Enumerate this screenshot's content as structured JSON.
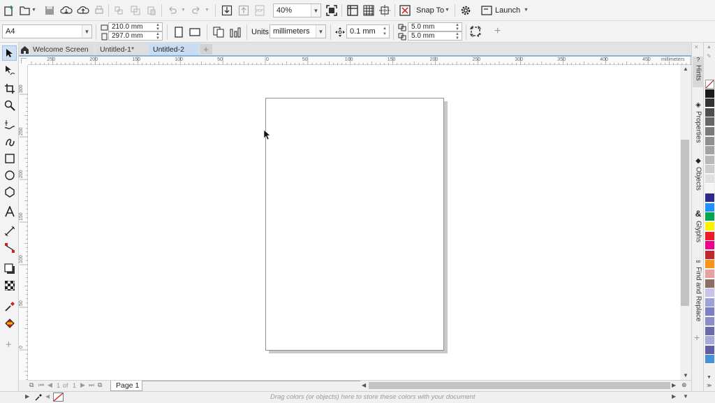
{
  "toolbar": {
    "zoom_value": "40%",
    "snap_label": "Snap To",
    "launch_label": "Launch"
  },
  "property_bar": {
    "page_size": "A4",
    "width_value": "210.0 mm",
    "height_value": "297.0 mm",
    "units_label": "Units:",
    "units_value": "millimeters",
    "nudge_value": "0.1 mm",
    "dup_x_value": "5.0 mm",
    "dup_y_value": "5.0 mm"
  },
  "tabs": [
    {
      "label": "Welcome Screen",
      "active": false
    },
    {
      "label": "Untitled-1*",
      "active": false
    },
    {
      "label": "Untitled-2",
      "active": true
    }
  ],
  "ruler": {
    "unit_label": "millimeters",
    "h_ticks": [
      "250",
      "200",
      "150",
      "100",
      "50",
      "0",
      "50",
      "100",
      "150",
      "200",
      "250",
      "300",
      "350",
      "400",
      "450"
    ],
    "v_ticks": [
      "300",
      "250",
      "200",
      "150",
      "100",
      "50",
      "0"
    ]
  },
  "page_nav": {
    "current": "1",
    "of_label": "of",
    "total": "1",
    "page_tab_label": "Page 1"
  },
  "status": {
    "hint": "Drag colors (or objects) here to store these colors with your document"
  },
  "dockers": [
    {
      "label": "Hints",
      "icon": "hints-icon"
    },
    {
      "label": "Properties",
      "icon": "properties-icon"
    },
    {
      "label": "Objects",
      "icon": "objects-icon"
    },
    {
      "label": "Glyphs",
      "icon": "glyphs-icon"
    },
    {
      "label": "Find and Replace",
      "icon": "find-replace-icon"
    }
  ],
  "palette": [
    "#ffffff",
    "#1a1a1a",
    "#333333",
    "#4d4d4d",
    "#666666",
    "#7a7a7a",
    "#8f8f8f",
    "#a3a3a3",
    "#b8b8b8",
    "#cccccc",
    "#e0e0e0",
    "#f5f5f5",
    "#2b2b8c",
    "#1e90ff",
    "#00a650",
    "#fff200",
    "#ed1c24",
    "#ec008c",
    "#c1272d",
    "#f7941d",
    "#e8a0a0",
    "#8c6e63",
    "#c9c3e6",
    "#9fa2d6",
    "#7b7fc4",
    "#8e8cc8",
    "#6b6aa8",
    "#a7a9d9",
    "#5e5ea0",
    "#4a90d9"
  ]
}
